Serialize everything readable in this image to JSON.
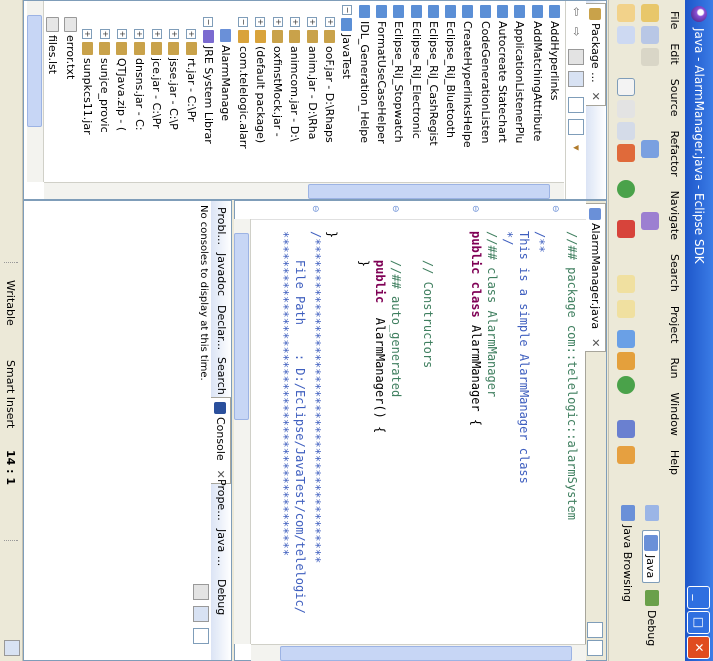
{
  "window": {
    "title": "Java - AlarmManager.java - Eclipse SDK"
  },
  "menu": [
    "File",
    "Edit",
    "Source",
    "Refactor",
    "Navigate",
    "Search",
    "Project",
    "Run",
    "Window",
    "Help"
  ],
  "perspectives": {
    "java": "Java",
    "debug": "Debug",
    "java_browsing": "Java Browsing"
  },
  "package_explorer": {
    "tab_label": "Package ...",
    "items": [
      {
        "label": "AddHyperlinks",
        "depth": 1,
        "icon": "project-folder-icon"
      },
      {
        "label": "AddMatchingAttribute",
        "depth": 1,
        "icon": "project-folder-icon"
      },
      {
        "label": "ApplicationListenerPlu",
        "depth": 1,
        "icon": "project-folder-icon"
      },
      {
        "label": "Autocreate Statechart",
        "depth": 1,
        "icon": "project-folder-icon"
      },
      {
        "label": "CodeGenerationListen",
        "depth": 1,
        "icon": "project-folder-icon"
      },
      {
        "label": "CreateHyperlinksHelpe",
        "depth": 1,
        "icon": "project-folder-icon"
      },
      {
        "label": "Eclipse_RiJ_Bluetooth",
        "depth": 1,
        "icon": "project-folder-icon"
      },
      {
        "label": "Eclipse_RiJ_CashRegist",
        "depth": 1,
        "icon": "project-folder-icon"
      },
      {
        "label": "Eclipse_RiJ_Electronic",
        "depth": 1,
        "icon": "project-folder-icon"
      },
      {
        "label": "Eclipse_RiJ_Stopwatch",
        "depth": 1,
        "icon": "project-folder-icon"
      },
      {
        "label": "FormatUseCaseHelper",
        "depth": 1,
        "icon": "project-folder-icon"
      },
      {
        "label": "IDL_Generation_Helpe",
        "depth": 1,
        "icon": "project-folder-icon"
      },
      {
        "label": "JavaTest",
        "depth": 1,
        "icon": "project-folder-icon",
        "expanded": true
      },
      {
        "label": "ooF.jar - D:\\Rhaps",
        "depth": 2,
        "icon": "jar-icon"
      },
      {
        "label": "anim.jar - D:\\Rha",
        "depth": 2,
        "icon": "jar-icon"
      },
      {
        "label": "animcom.jar - D:\\",
        "depth": 2,
        "icon": "jar-icon"
      },
      {
        "label": "oxfinstMock.jar -",
        "depth": 2,
        "icon": "jar-icon"
      },
      {
        "label": "(default package)",
        "depth": 2,
        "icon": "package-icon"
      },
      {
        "label": "com.telelogic.alarr",
        "depth": 2,
        "icon": "package-icon",
        "expanded": true
      },
      {
        "label": "AlarmManage",
        "depth": 3,
        "icon": "java-file-icon"
      },
      {
        "label": "JRE System Librar",
        "depth": 2,
        "icon": "library-icon",
        "expanded": true
      },
      {
        "label": "rt.jar - C:\\Pr",
        "depth": 3,
        "icon": "jar-icon"
      },
      {
        "label": "jsse.jar - C:\\P",
        "depth": 3,
        "icon": "jar-icon"
      },
      {
        "label": "jce.jar - C:\\Pr",
        "depth": 3,
        "icon": "jar-icon"
      },
      {
        "label": "dnsns.jar - C:",
        "depth": 3,
        "icon": "jar-icon"
      },
      {
        "label": "QTJava.zip - (",
        "depth": 3,
        "icon": "jar-icon"
      },
      {
        "label": "sunjce_provic",
        "depth": 3,
        "icon": "jar-icon"
      },
      {
        "label": "sunpkcs11.jar",
        "depth": 3,
        "icon": "jar-icon"
      },
      {
        "label": "error.txt",
        "depth": 2,
        "icon": "text-file-icon"
      },
      {
        "label": "files.lst",
        "depth": 2,
        "icon": "text-file-icon"
      }
    ]
  },
  "editor": {
    "tab_label": "AlarmManager.java",
    "lines": [
      [
        {
          "t": "//## package com::telelogic::alarmSystem",
          "c": "c"
        }
      ],
      [
        {
          "t": "",
          "c": ""
        }
      ],
      [
        {
          "t": "/**",
          "c": "jd"
        }
      ],
      [
        {
          "t": "This is a simple AlarmManager class",
          "c": "jd"
        }
      ],
      [
        {
          "t": "*/",
          "c": "jd"
        }
      ],
      [
        {
          "t": "//## class AlarmManager",
          "c": "c"
        }
      ],
      [
        {
          "t": "public",
          "c": "k"
        },
        {
          "t": " ",
          "c": ""
        },
        {
          "t": "class",
          "c": "k"
        },
        {
          "t": " AlarmManager {",
          "c": ""
        }
      ],
      [
        {
          "t": "",
          "c": ""
        }
      ],
      [
        {
          "t": "",
          "c": ""
        }
      ],
      [
        {
          "t": "    // Constructors",
          "c": "c"
        }
      ],
      [
        {
          "t": "",
          "c": ""
        }
      ],
      [
        {
          "t": "    //## auto_generated",
          "c": "c"
        }
      ],
      [
        {
          "t": "    ",
          "c": ""
        },
        {
          "t": "public",
          "c": "k"
        },
        {
          "t": "  AlarmManager() {",
          "c": ""
        }
      ],
      [
        {
          "t": "    }",
          "c": ""
        }
      ],
      [
        {
          "t": "",
          "c": ""
        }
      ],
      [
        {
          "t": "}",
          "c": ""
        }
      ],
      [
        {
          "t": "/*********************************************",
          "c": "jd"
        }
      ],
      [
        {
          "t": "    File Path    : D:/Eclipse/JavaTest/com/telelogic/",
          "c": "jd"
        }
      ],
      [
        {
          "t": "*********************************************",
          "c": "jd"
        }
      ]
    ]
  },
  "bottom_tabs": [
    "Probl...",
    "Javadoc",
    "Declar...",
    "Search",
    "Console",
    "Prope...",
    "Java ...",
    "Debug"
  ],
  "console": {
    "message": "No consoles to display at this time."
  },
  "status": {
    "writable": "Writable",
    "insert_mode": "Smart Insert",
    "position": "14 : 1"
  }
}
